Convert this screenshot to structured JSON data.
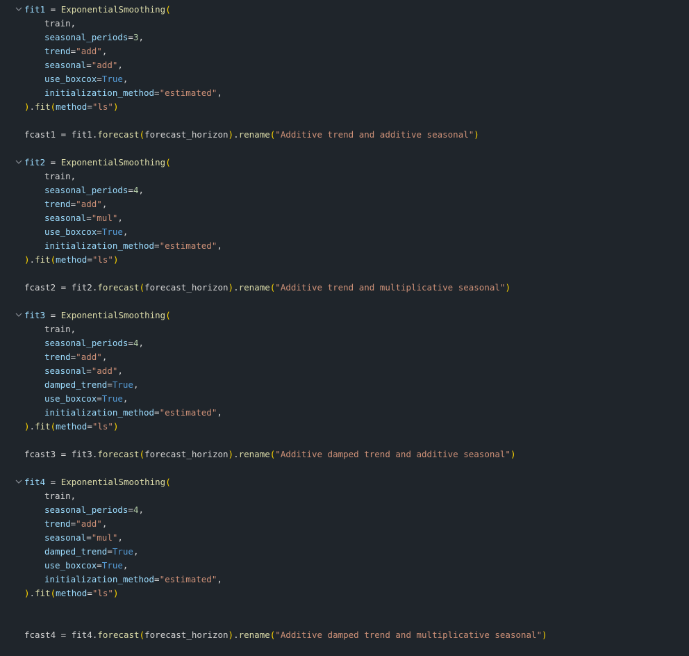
{
  "editor": {
    "language": "python",
    "fold_icon": "chevron-down-icon",
    "lines": [
      {
        "n": 1,
        "fold": true,
        "indent": 0,
        "tokens": [
          [
            "fit1",
            "var"
          ],
          [
            " = ",
            "op"
          ],
          [
            "ExponentialSmoothing",
            "fn"
          ],
          [
            "(",
            "p1"
          ]
        ]
      },
      {
        "n": 2,
        "indent": 1,
        "tokens": [
          [
            "train",
            "name"
          ],
          [
            ",",
            "op"
          ]
        ]
      },
      {
        "n": 3,
        "indent": 1,
        "tokens": [
          [
            "seasonal_periods",
            "kw"
          ],
          [
            "=",
            "op"
          ],
          [
            "3",
            "num"
          ],
          [
            ",",
            "op"
          ]
        ]
      },
      {
        "n": 4,
        "indent": 1,
        "tokens": [
          [
            "trend",
            "kw"
          ],
          [
            "=",
            "op"
          ],
          [
            "\"add\"",
            "str"
          ],
          [
            ",",
            "op"
          ]
        ]
      },
      {
        "n": 5,
        "indent": 1,
        "tokens": [
          [
            "seasonal",
            "kw"
          ],
          [
            "=",
            "op"
          ],
          [
            "\"add\"",
            "str"
          ],
          [
            ",",
            "op"
          ]
        ]
      },
      {
        "n": 6,
        "indent": 1,
        "tokens": [
          [
            "use_boxcox",
            "kw"
          ],
          [
            "=",
            "op"
          ],
          [
            "True",
            "const"
          ],
          [
            ",",
            "op"
          ]
        ]
      },
      {
        "n": 7,
        "indent": 1,
        "tokens": [
          [
            "initialization_method",
            "kw"
          ],
          [
            "=",
            "op"
          ],
          [
            "\"estimated\"",
            "str"
          ],
          [
            ",",
            "op"
          ]
        ]
      },
      {
        "n": 8,
        "indent": 0,
        "tokens": [
          [
            ")",
            "p1"
          ],
          [
            ".",
            "op"
          ],
          [
            "fit",
            "fn"
          ],
          [
            "(",
            "p1"
          ],
          [
            "method",
            "kw"
          ],
          [
            "=",
            "op"
          ],
          [
            "\"ls\"",
            "str"
          ],
          [
            ")",
            "p1"
          ]
        ]
      },
      {
        "n": 9,
        "indent": 0,
        "tokens": []
      },
      {
        "n": 10,
        "indent": 0,
        "tokens": [
          [
            "fcast1",
            "name"
          ],
          [
            " = ",
            "op"
          ],
          [
            "fit1",
            "name"
          ],
          [
            ".",
            "op"
          ],
          [
            "forecast",
            "fn"
          ],
          [
            "(",
            "p1"
          ],
          [
            "forecast_horizon",
            "name"
          ],
          [
            ")",
            "p1"
          ],
          [
            ".",
            "op"
          ],
          [
            "rename",
            "fn"
          ],
          [
            "(",
            "p1"
          ],
          [
            "\"Additive trend and additive seasonal\"",
            "str"
          ],
          [
            ")",
            "p1"
          ]
        ]
      },
      {
        "n": 11,
        "indent": 0,
        "tokens": []
      },
      {
        "n": 12,
        "fold": true,
        "indent": 0,
        "tokens": [
          [
            "fit2",
            "var"
          ],
          [
            " = ",
            "op"
          ],
          [
            "ExponentialSmoothing",
            "fn"
          ],
          [
            "(",
            "p1"
          ]
        ]
      },
      {
        "n": 13,
        "indent": 1,
        "tokens": [
          [
            "train",
            "name"
          ],
          [
            ",",
            "op"
          ]
        ]
      },
      {
        "n": 14,
        "indent": 1,
        "tokens": [
          [
            "seasonal_periods",
            "kw"
          ],
          [
            "=",
            "op"
          ],
          [
            "4",
            "num"
          ],
          [
            ",",
            "op"
          ]
        ]
      },
      {
        "n": 15,
        "indent": 1,
        "tokens": [
          [
            "trend",
            "kw"
          ],
          [
            "=",
            "op"
          ],
          [
            "\"add\"",
            "str"
          ],
          [
            ",",
            "op"
          ]
        ]
      },
      {
        "n": 16,
        "indent": 1,
        "tokens": [
          [
            "seasonal",
            "kw"
          ],
          [
            "=",
            "op"
          ],
          [
            "\"mul\"",
            "str"
          ],
          [
            ",",
            "op"
          ]
        ]
      },
      {
        "n": 17,
        "indent": 1,
        "tokens": [
          [
            "use_boxcox",
            "kw"
          ],
          [
            "=",
            "op"
          ],
          [
            "True",
            "const"
          ],
          [
            ",",
            "op"
          ]
        ]
      },
      {
        "n": 18,
        "indent": 1,
        "tokens": [
          [
            "initialization_method",
            "kw"
          ],
          [
            "=",
            "op"
          ],
          [
            "\"estimated\"",
            "str"
          ],
          [
            ",",
            "op"
          ]
        ]
      },
      {
        "n": 19,
        "indent": 0,
        "tokens": [
          [
            ")",
            "p1"
          ],
          [
            ".",
            "op"
          ],
          [
            "fit",
            "fn"
          ],
          [
            "(",
            "p1"
          ],
          [
            "method",
            "kw"
          ],
          [
            "=",
            "op"
          ],
          [
            "\"ls\"",
            "str"
          ],
          [
            ")",
            "p1"
          ]
        ]
      },
      {
        "n": 20,
        "indent": 0,
        "tokens": []
      },
      {
        "n": 21,
        "indent": 0,
        "tokens": [
          [
            "fcast2",
            "name"
          ],
          [
            " = ",
            "op"
          ],
          [
            "fit2",
            "name"
          ],
          [
            ".",
            "op"
          ],
          [
            "forecast",
            "fn"
          ],
          [
            "(",
            "p1"
          ],
          [
            "forecast_horizon",
            "name"
          ],
          [
            ")",
            "p1"
          ],
          [
            ".",
            "op"
          ],
          [
            "rename",
            "fn"
          ],
          [
            "(",
            "p1"
          ],
          [
            "\"Additive trend and multiplicative seasonal\"",
            "str"
          ],
          [
            ")",
            "p1"
          ]
        ]
      },
      {
        "n": 22,
        "indent": 0,
        "tokens": []
      },
      {
        "n": 23,
        "fold": true,
        "indent": 0,
        "tokens": [
          [
            "fit3",
            "var"
          ],
          [
            " = ",
            "op"
          ],
          [
            "ExponentialSmoothing",
            "fn"
          ],
          [
            "(",
            "p1"
          ]
        ]
      },
      {
        "n": 24,
        "indent": 1,
        "tokens": [
          [
            "train",
            "name"
          ],
          [
            ",",
            "op"
          ]
        ]
      },
      {
        "n": 25,
        "indent": 1,
        "tokens": [
          [
            "seasonal_periods",
            "kw"
          ],
          [
            "=",
            "op"
          ],
          [
            "4",
            "num"
          ],
          [
            ",",
            "op"
          ]
        ]
      },
      {
        "n": 26,
        "indent": 1,
        "tokens": [
          [
            "trend",
            "kw"
          ],
          [
            "=",
            "op"
          ],
          [
            "\"add\"",
            "str"
          ],
          [
            ",",
            "op"
          ]
        ]
      },
      {
        "n": 27,
        "indent": 1,
        "tokens": [
          [
            "seasonal",
            "kw"
          ],
          [
            "=",
            "op"
          ],
          [
            "\"add\"",
            "str"
          ],
          [
            ",",
            "op"
          ]
        ]
      },
      {
        "n": 28,
        "indent": 1,
        "tokens": [
          [
            "damped_trend",
            "kw"
          ],
          [
            "=",
            "op"
          ],
          [
            "True",
            "const"
          ],
          [
            ",",
            "op"
          ]
        ]
      },
      {
        "n": 29,
        "indent": 1,
        "tokens": [
          [
            "use_boxcox",
            "kw"
          ],
          [
            "=",
            "op"
          ],
          [
            "True",
            "const"
          ],
          [
            ",",
            "op"
          ]
        ]
      },
      {
        "n": 30,
        "indent": 1,
        "tokens": [
          [
            "initialization_method",
            "kw"
          ],
          [
            "=",
            "op"
          ],
          [
            "\"estimated\"",
            "str"
          ],
          [
            ",",
            "op"
          ]
        ]
      },
      {
        "n": 31,
        "indent": 0,
        "tokens": [
          [
            ")",
            "p1"
          ],
          [
            ".",
            "op"
          ],
          [
            "fit",
            "fn"
          ],
          [
            "(",
            "p1"
          ],
          [
            "method",
            "kw"
          ],
          [
            "=",
            "op"
          ],
          [
            "\"ls\"",
            "str"
          ],
          [
            ")",
            "p1"
          ]
        ]
      },
      {
        "n": 32,
        "indent": 0,
        "tokens": []
      },
      {
        "n": 33,
        "indent": 0,
        "tokens": [
          [
            "fcast3",
            "name"
          ],
          [
            " = ",
            "op"
          ],
          [
            "fit3",
            "name"
          ],
          [
            ".",
            "op"
          ],
          [
            "forecast",
            "fn"
          ],
          [
            "(",
            "p1"
          ],
          [
            "forecast_horizon",
            "name"
          ],
          [
            ")",
            "p1"
          ],
          [
            ".",
            "op"
          ],
          [
            "rename",
            "fn"
          ],
          [
            "(",
            "p1"
          ],
          [
            "\"Additive damped trend and additive seasonal\"",
            "str"
          ],
          [
            ")",
            "p1"
          ]
        ]
      },
      {
        "n": 34,
        "indent": 0,
        "tokens": []
      },
      {
        "n": 35,
        "fold": true,
        "indent": 0,
        "tokens": [
          [
            "fit4",
            "var"
          ],
          [
            " = ",
            "op"
          ],
          [
            "ExponentialSmoothing",
            "fn"
          ],
          [
            "(",
            "p1"
          ]
        ]
      },
      {
        "n": 36,
        "indent": 1,
        "tokens": [
          [
            "train",
            "name"
          ],
          [
            ",",
            "op"
          ]
        ]
      },
      {
        "n": 37,
        "indent": 1,
        "tokens": [
          [
            "seasonal_periods",
            "kw"
          ],
          [
            "=",
            "op"
          ],
          [
            "4",
            "num"
          ],
          [
            ",",
            "op"
          ]
        ]
      },
      {
        "n": 38,
        "indent": 1,
        "tokens": [
          [
            "trend",
            "kw"
          ],
          [
            "=",
            "op"
          ],
          [
            "\"add\"",
            "str"
          ],
          [
            ",",
            "op"
          ]
        ]
      },
      {
        "n": 39,
        "indent": 1,
        "tokens": [
          [
            "seasonal",
            "kw"
          ],
          [
            "=",
            "op"
          ],
          [
            "\"mul\"",
            "str"
          ],
          [
            ",",
            "op"
          ]
        ]
      },
      {
        "n": 40,
        "indent": 1,
        "tokens": [
          [
            "damped_trend",
            "kw"
          ],
          [
            "=",
            "op"
          ],
          [
            "True",
            "const"
          ],
          [
            ",",
            "op"
          ]
        ]
      },
      {
        "n": 41,
        "indent": 1,
        "tokens": [
          [
            "use_boxcox",
            "kw"
          ],
          [
            "=",
            "op"
          ],
          [
            "True",
            "const"
          ],
          [
            ",",
            "op"
          ]
        ]
      },
      {
        "n": 42,
        "indent": 1,
        "tokens": [
          [
            "initialization_method",
            "kw"
          ],
          [
            "=",
            "op"
          ],
          [
            "\"estimated\"",
            "str"
          ],
          [
            ",",
            "op"
          ]
        ]
      },
      {
        "n": 43,
        "indent": 0,
        "tokens": [
          [
            ")",
            "p1"
          ],
          [
            ".",
            "op"
          ],
          [
            "fit",
            "fn"
          ],
          [
            "(",
            "p1"
          ],
          [
            "method",
            "kw"
          ],
          [
            "=",
            "op"
          ],
          [
            "\"ls\"",
            "str"
          ],
          [
            ")",
            "p1"
          ]
        ]
      },
      {
        "n": 44,
        "indent": 0,
        "tokens": []
      },
      {
        "n": 45,
        "indent": 0,
        "tokens": []
      },
      {
        "n": 46,
        "indent": 0,
        "tokens": [
          [
            "fcast4",
            "name"
          ],
          [
            " = ",
            "op"
          ],
          [
            "fit4",
            "name"
          ],
          [
            ".",
            "op"
          ],
          [
            "forecast",
            "fn"
          ],
          [
            "(",
            "p1"
          ],
          [
            "forecast_horizon",
            "name"
          ],
          [
            ")",
            "p1"
          ],
          [
            ".",
            "op"
          ],
          [
            "rename",
            "fn"
          ],
          [
            "(",
            "p1"
          ],
          [
            "\"Additive damped trend and multiplicative seasonal\"",
            "str"
          ],
          [
            ")",
            "p1"
          ]
        ]
      }
    ]
  }
}
